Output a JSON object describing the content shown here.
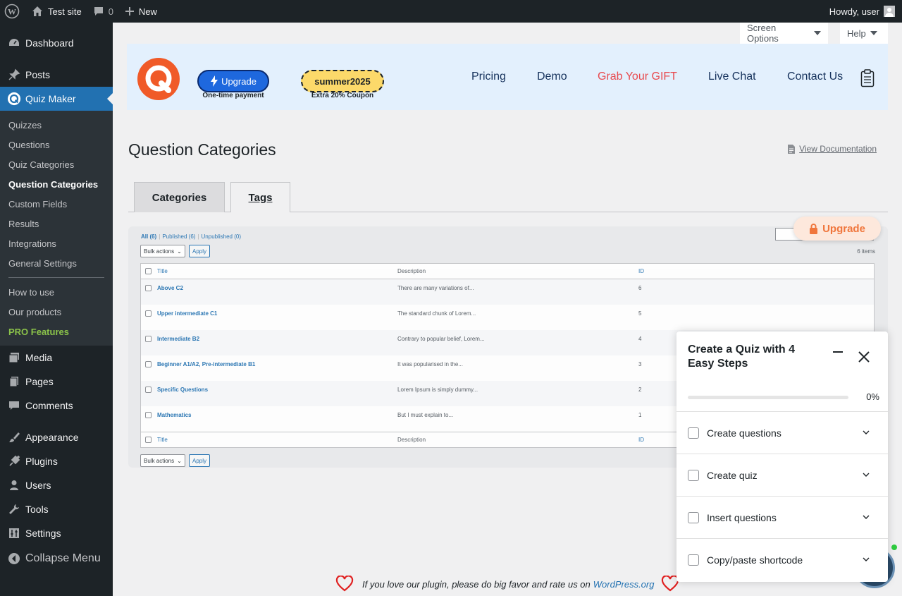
{
  "adminbar": {
    "site_name": "Test site",
    "comments_count": "0",
    "new_label": "New",
    "howdy": "Howdy, user"
  },
  "sidebar": {
    "top_items": [
      {
        "label": "Dashboard",
        "icon": "dashboard-icon"
      },
      {
        "label": "Posts",
        "icon": "pin-icon"
      },
      {
        "label": "Quiz Maker",
        "icon": "quiz-maker-icon",
        "active": true
      }
    ],
    "submenu": [
      "Quizzes",
      "Questions",
      "Quiz Categories",
      "Question Categories",
      "Custom Fields",
      "Results",
      "Integrations",
      "General Settings"
    ],
    "submenu_extra": [
      "How to use",
      "Our products",
      "PRO Features"
    ],
    "lower_items": [
      "Media",
      "Pages",
      "Comments",
      "Appearance",
      "Plugins",
      "Users",
      "Tools",
      "Settings",
      "Collapse Menu"
    ]
  },
  "screen_meta": {
    "screen_options": "Screen Options",
    "help": "Help"
  },
  "banner": {
    "upgrade_label": "Upgrade",
    "upgrade_sub": "One-time payment",
    "coupon_label": "summer2025",
    "coupon_sub": "Extra 20% Coupon",
    "nav": [
      "Pricing",
      "Demo",
      "Grab Your GIFT",
      "Live Chat",
      "Contact Us"
    ]
  },
  "page": {
    "title": "Question Categories",
    "view_doc": "View Documentation"
  },
  "tabs": [
    "Categories",
    "Tags"
  ],
  "preview": {
    "filters": [
      "All (6)",
      "Published (6)",
      "Unpublished (0)"
    ],
    "bulk_actions": "Bulk actions",
    "apply": "Apply",
    "items_count": "6 items",
    "columns": [
      "Title",
      "Description",
      "ID"
    ],
    "rows": [
      {
        "title": "Above C2",
        "desc": "There are many variations of...",
        "id": "6"
      },
      {
        "title": "Upper intermediate C1",
        "desc": "The standard chunk of Lorem...",
        "id": "5"
      },
      {
        "title": "Intermediate B2",
        "desc": "Contrary to popular belief, Lorem...",
        "id": "4"
      },
      {
        "title": "Beginner A1/A2, Pre-intermediate B1",
        "desc": "It was popularised in the...",
        "id": "3"
      },
      {
        "title": "Specific Questions",
        "desc": "Lorem Ipsum is simply dummy...",
        "id": "2"
      },
      {
        "title": "Mathematics",
        "desc": "But I must explain to...",
        "id": "1"
      }
    ],
    "upgrade_label": "Upgrade"
  },
  "footer": {
    "text": "If you love our plugin, please do big favor and rate us on",
    "link": "WordPress.org"
  },
  "steps_widget": {
    "title": "Create a Quiz with 4 Easy Steps",
    "progress": 0,
    "progress_label": "0%",
    "steps": [
      "Create questions",
      "Create quiz",
      "Insert questions",
      "Copy/paste shortcode"
    ]
  }
}
